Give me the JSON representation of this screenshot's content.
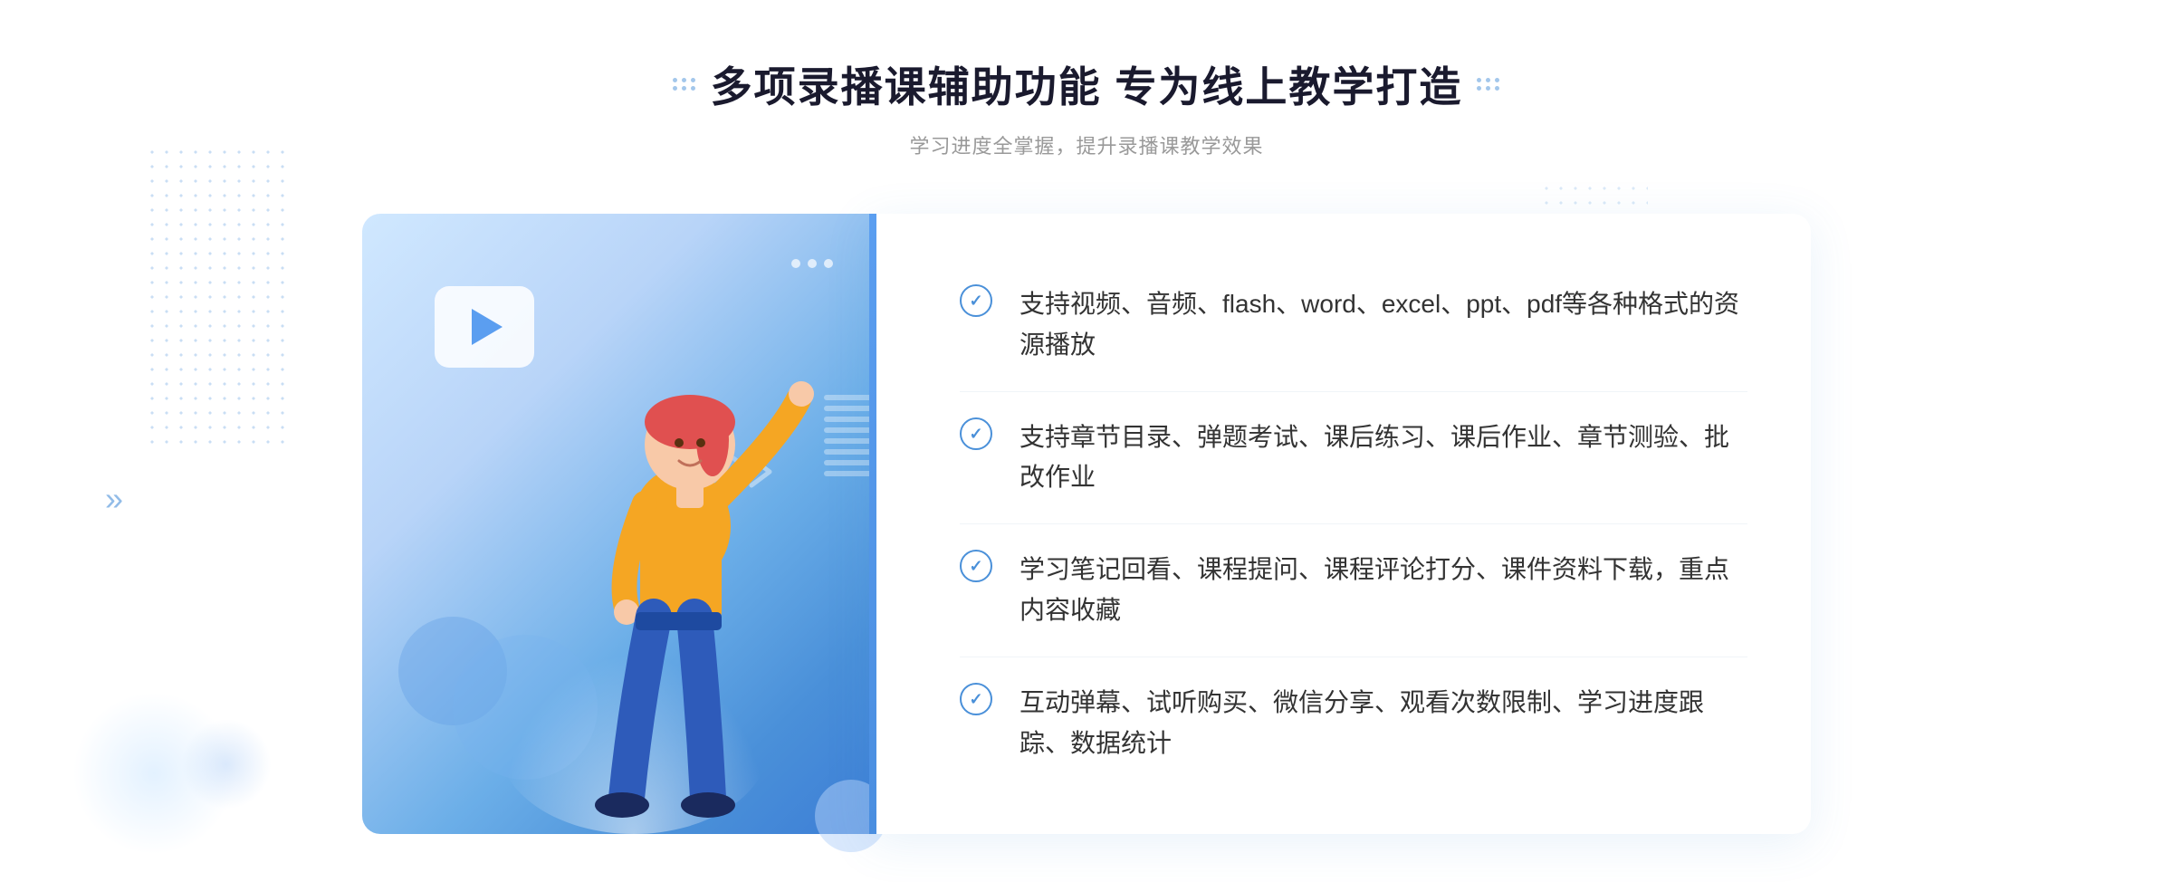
{
  "page": {
    "background_color": "#ffffff"
  },
  "header": {
    "title": "多项录播课辅助功能 专为线上教学打造",
    "subtitle": "学习进度全掌握，提升录播课教学效果",
    "title_decoration_left": "decoration-dots",
    "title_decoration_right": "decoration-dots"
  },
  "features": [
    {
      "id": 1,
      "text": "支持视频、音频、flash、word、excel、ppt、pdf等各种格式的资源播放"
    },
    {
      "id": 2,
      "text": "支持章节目录、弹题考试、课后练习、课后作业、章节测验、批改作业"
    },
    {
      "id": 3,
      "text": "学习笔记回看、课程提问、课程评论打分、课件资料下载，重点内容收藏"
    },
    {
      "id": 4,
      "text": "互动弹幕、试听购买、微信分享、观看次数限制、学习进度跟踪、数据统计"
    }
  ],
  "colors": {
    "primary_blue": "#4a90d9",
    "light_blue": "#5b9ef0",
    "text_dark": "#1a1a2e",
    "text_gray": "#999999",
    "text_body": "#333333",
    "accent": "#3a7bd5"
  },
  "icons": {
    "check": "✓",
    "play": "▶",
    "chevron_left": "»",
    "chevron_right": "«"
  }
}
